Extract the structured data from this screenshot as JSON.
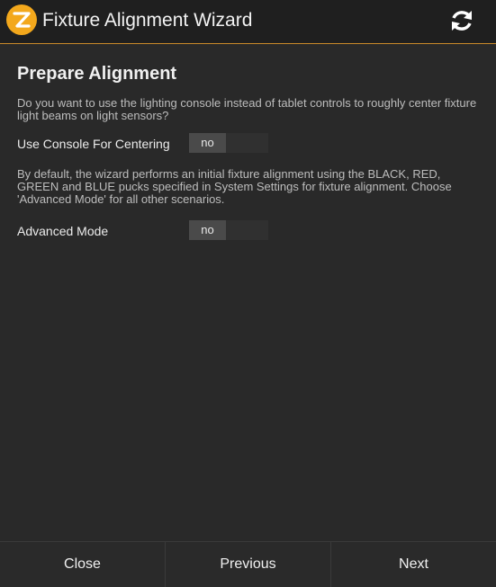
{
  "app": {
    "title": "Fixture Alignment Wizard",
    "logo_icon": "app-logo-icon",
    "refresh_icon": "refresh-icon",
    "accent_color": "#c9892a"
  },
  "step": {
    "heading": "Prepare Alignment",
    "console_description": "Do you want to use the lighting console instead of tablet controls to roughly center fixture light beams on light sensors?",
    "console_label": "Use Console For Centering",
    "console_value": "no",
    "advanced_description": "By default, the wizard performs an initial fixture alignment using the BLACK, RED, GREEN and BLUE pucks specified in System Settings for fixture alignment. Choose 'Advanced Mode' for all other scenarios.",
    "advanced_label": "Advanced Mode",
    "advanced_value": "no"
  },
  "footer": {
    "close_label": "Close",
    "previous_label": "Previous",
    "next_label": "Next"
  }
}
